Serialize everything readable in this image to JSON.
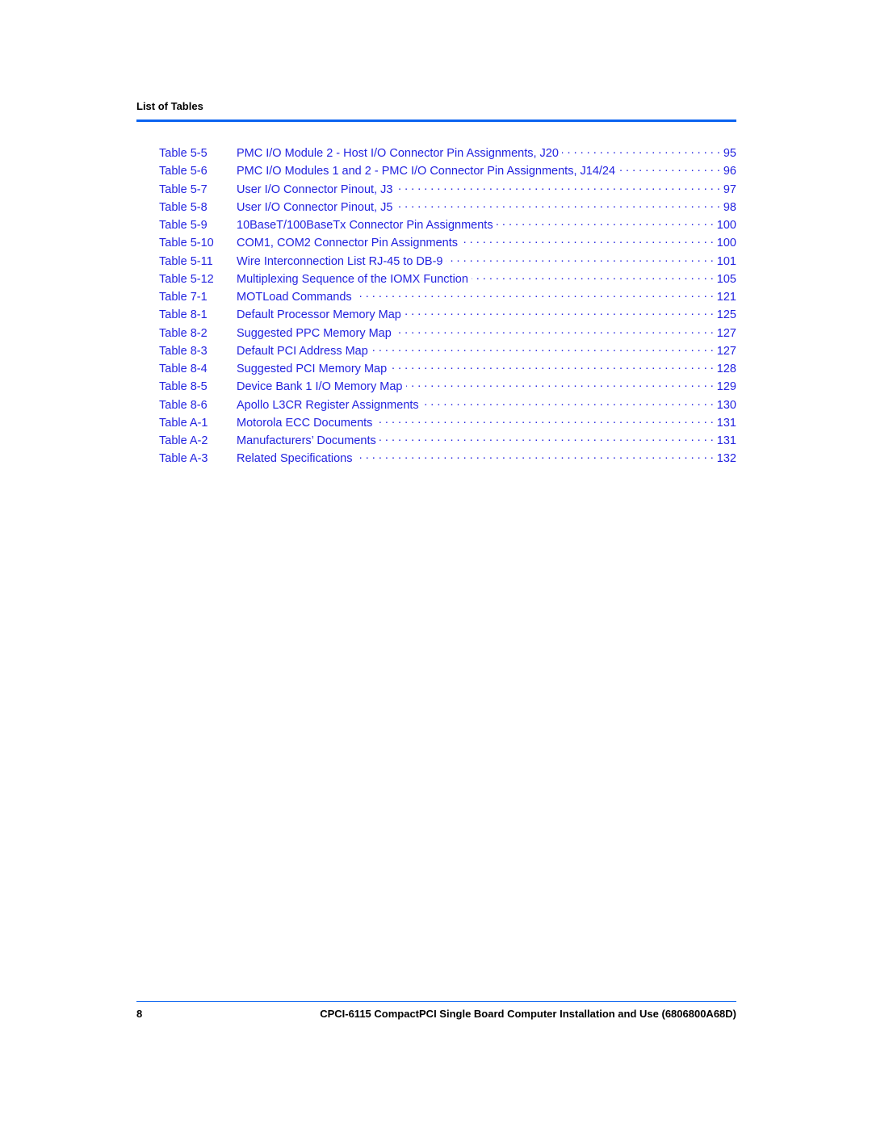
{
  "header": {
    "title": "List of Tables"
  },
  "entries": [
    {
      "number": "Table 5-5",
      "title": "PMC I/O Module 2 - Host I/O Connector Pin Assignments, J20",
      "page": "95"
    },
    {
      "number": "Table 5-6",
      "title": "PMC I/O Modules 1 and 2 - PMC I/O Connector Pin Assignments, J14/24",
      "page": "96"
    },
    {
      "number": "Table 5-7",
      "title": "User I/O Connector Pinout, J3",
      "page": "97"
    },
    {
      "number": "Table 5-8",
      "title": "User I/O Connector Pinout, J5",
      "page": "98"
    },
    {
      "number": "Table 5-9",
      "title": "10BaseT/100BaseTx Connector Pin Assignments",
      "page": "100"
    },
    {
      "number": "Table 5-10",
      "title": "COM1, COM2 Connector Pin Assignments",
      "page": "100"
    },
    {
      "number": "Table 5-11",
      "title": "Wire Interconnection List RJ-45 to DB-9",
      "page": "101"
    },
    {
      "number": "Table 5-12",
      "title": "Multiplexing Sequence of the IOMX Function",
      "page": "105"
    },
    {
      "number": "Table 7-1",
      "title": "MOTLoad Commands",
      "page": "121"
    },
    {
      "number": "Table 8-1",
      "title": "Default Processor Memory Map",
      "page": "125"
    },
    {
      "number": "Table 8-2",
      "title": "Suggested PPC Memory Map",
      "page": "127"
    },
    {
      "number": "Table 8-3",
      "title": "Default PCI Address Map",
      "page": "127"
    },
    {
      "number": "Table 8-4",
      "title": "Suggested PCI Memory Map",
      "page": "128"
    },
    {
      "number": "Table 8-5",
      "title": "Device Bank 1 I/O Memory Map",
      "page": "129"
    },
    {
      "number": "Table 8-6",
      "title": "Apollo L3CR Register Assignments",
      "page": "130"
    },
    {
      "number": "Table A-1",
      "title": "Motorola ECC Documents",
      "page": "131"
    },
    {
      "number": "Table A-2",
      "title": "Manufacturers’ Documents",
      "page": "131"
    },
    {
      "number": "Table A-3",
      "title": "Related Specifications",
      "page": "132"
    }
  ],
  "footer": {
    "page_number": "8",
    "document_title": "CPCI-6115 CompactPCI Single Board Computer Installation and Use (6806800A68D)"
  },
  "colors": {
    "link": "#2323e0",
    "rule": "#0a63f0",
    "text": "#000000"
  }
}
